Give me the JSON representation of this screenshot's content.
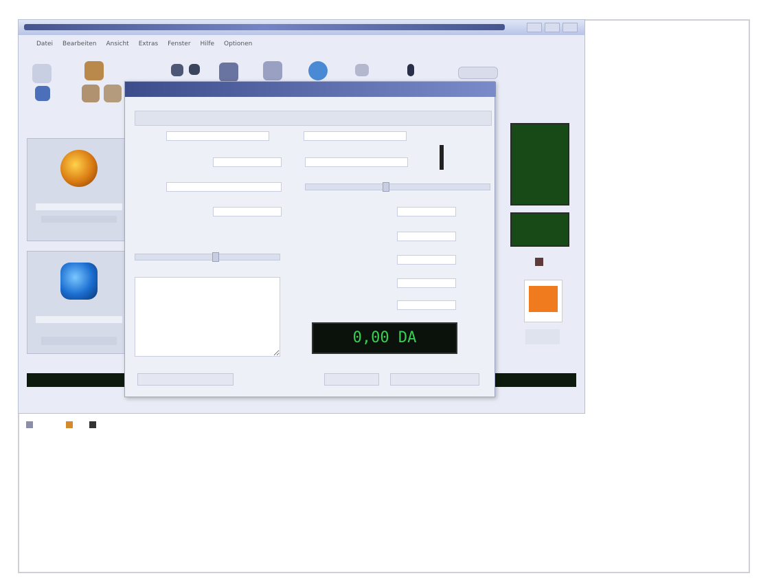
{
  "window": {
    "title": "",
    "menu": [
      "Datei",
      "Bearbeiten",
      "Ansicht",
      "Extras",
      "Fenster",
      "Hilfe",
      "Optionen"
    ]
  },
  "dialog": {
    "title": "",
    "header_left": "",
    "header_right": "",
    "row1_left": "",
    "row1_right": "",
    "fields_left": [
      {
        "label": "",
        "value": ""
      },
      {
        "label": "",
        "value": ""
      },
      {
        "label": "",
        "value": ""
      }
    ],
    "fields_right": [
      {
        "label": "",
        "value": ""
      },
      {
        "label": "",
        "value": ""
      },
      {
        "label": "",
        "value": ""
      },
      {
        "label": "",
        "value": ""
      },
      {
        "label": "",
        "value": ""
      }
    ],
    "notes_label": "",
    "display_value": "0,00 DA",
    "buttons": [
      "",
      "",
      ""
    ]
  },
  "taskbar": {
    "items": [
      "",
      "",
      "",
      "",
      "",
      "",
      "",
      "",
      ""
    ]
  },
  "colors": {
    "accent": "#3d4d8c",
    "lcd_text": "#38d052",
    "lcd_bg": "#0b120b",
    "meter_green": "#174a17"
  }
}
